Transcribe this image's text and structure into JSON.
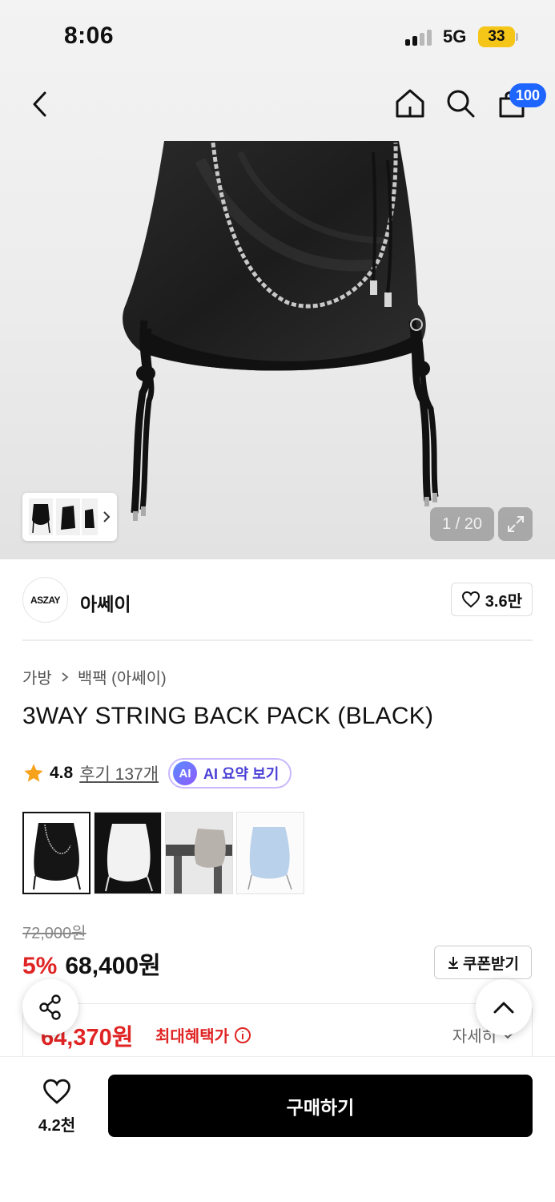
{
  "status_bar": {
    "time": "8:06",
    "network": "5G",
    "battery": "33"
  },
  "nav": {
    "cart_count": "100"
  },
  "hero": {
    "counter": "1 / 20"
  },
  "brand": {
    "logo_text": "ASZAY",
    "name": "아쎄이",
    "like_count": "3.6만"
  },
  "breadcrumb": {
    "category": "가방",
    "subcategory": "백팩 (아쎄이)"
  },
  "product": {
    "title": "3WAY STRING BACK PACK (BLACK)",
    "rating": "4.8",
    "reviews": "후기 137개",
    "ai_label": "AI 요약 보기",
    "ai_badge": "AI"
  },
  "variants": [
    {
      "name": "black",
      "color": "#151515"
    },
    {
      "name": "white",
      "color": "#f2f2f2"
    },
    {
      "name": "grey",
      "color": "#b8b2ad"
    },
    {
      "name": "sky",
      "color": "#b9d1ea"
    }
  ],
  "price": {
    "original": "72,000원",
    "discount": "5%",
    "sale": "68,400원",
    "coupon_label": "쿠폰받기",
    "max_benefit_price": "64,370원",
    "max_benefit_label": "최대혜택가",
    "detail_label": "자세히"
  },
  "bottom_bar": {
    "like_count": "4.2천",
    "buy_label": "구매하기"
  },
  "colors": {
    "accent_blue": "#1e64ff",
    "sale_red": "#e02424",
    "star": "#f7a21b"
  }
}
